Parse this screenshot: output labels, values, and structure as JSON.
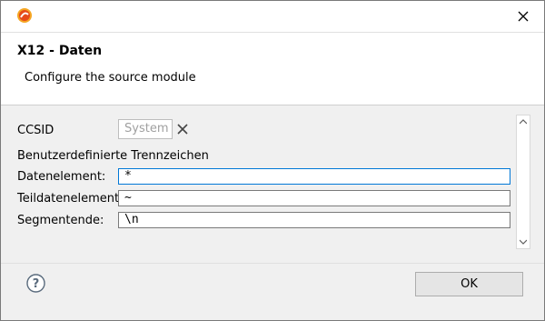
{
  "dialog": {
    "title": "X12 - Daten",
    "subtitle": "Configure the source module"
  },
  "form": {
    "ccsid_label": "CCSID",
    "ccsid_placeholder": "System",
    "section_label": "Benutzerdefinierte Trennzeichen",
    "fields": [
      {
        "label": "Datenelement:",
        "value": "*"
      },
      {
        "label": "Teildatenelement:",
        "value": "~"
      },
      {
        "label": "Segmentende:",
        "value": "\\n"
      }
    ]
  },
  "buttons": {
    "ok_label": "OK"
  },
  "icons": {
    "app": "app-logo-icon",
    "close": "close-icon",
    "clear": "clear-icon",
    "help": "help-icon",
    "scroll_up": "scroll-up-icon",
    "scroll_down": "scroll-down-icon"
  },
  "colors": {
    "focus_border": "#0078d7",
    "window_bg": "#f0f0f0"
  }
}
